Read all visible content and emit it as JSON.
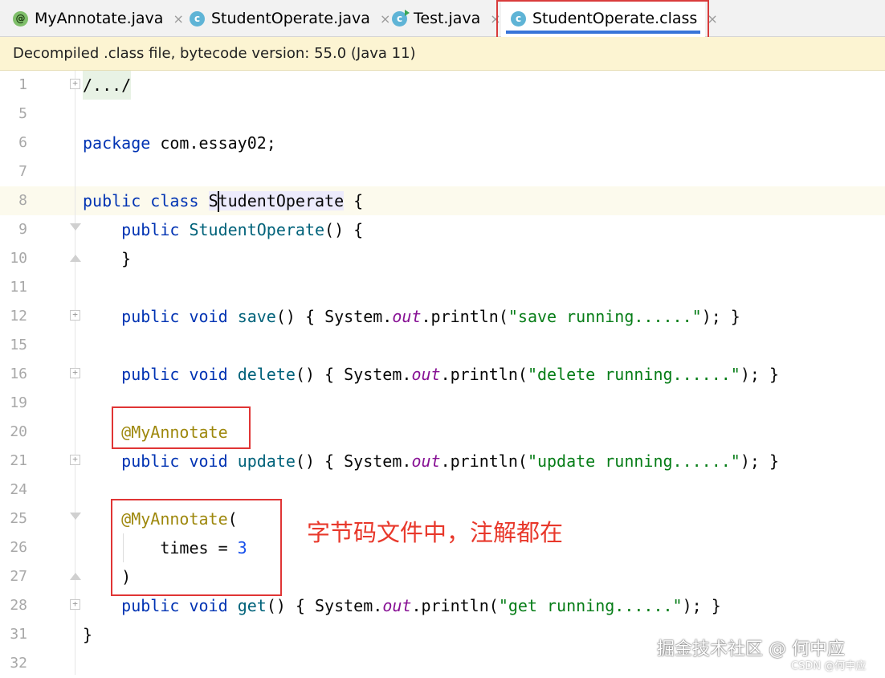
{
  "tabs": [
    {
      "label": "MyAnnotate.java",
      "icon": "annotation-icon",
      "active": false
    },
    {
      "label": "StudentOperate.java",
      "icon": "class-icon",
      "active": false
    },
    {
      "label": "Test.java",
      "icon": "runnable-class-icon",
      "active": false
    },
    {
      "label": "StudentOperate.class",
      "icon": "class-icon",
      "active": true
    }
  ],
  "tab_close_glyph": "×",
  "banner": "Decompiled .class file, bytecode version: 55.0 (Java 11)",
  "lines": [
    {
      "num": "1",
      "text": "/.../"
    },
    {
      "num": "5",
      "text": ""
    },
    {
      "num": "6",
      "text": "package com.essay02;"
    },
    {
      "num": "7",
      "text": ""
    },
    {
      "num": "8",
      "text": "public class StudentOperate {"
    },
    {
      "num": "9",
      "text": "    public StudentOperate() {"
    },
    {
      "num": "10",
      "text": "    }"
    },
    {
      "num": "11",
      "text": ""
    },
    {
      "num": "12",
      "text": "    public void save() { System.out.println(\"save running......\"); }"
    },
    {
      "num": "15",
      "text": ""
    },
    {
      "num": "16",
      "text": "    public void delete() { System.out.println(\"delete running......\"); }"
    },
    {
      "num": "19",
      "text": ""
    },
    {
      "num": "20",
      "text": "    @MyAnnotate"
    },
    {
      "num": "21",
      "text": "    public void update() { System.out.println(\"update running......\"); }"
    },
    {
      "num": "24",
      "text": ""
    },
    {
      "num": "25",
      "text": "    @MyAnnotate("
    },
    {
      "num": "26",
      "text": "        times = 3"
    },
    {
      "num": "27",
      "text": "    )"
    },
    {
      "num": "28",
      "text": "    public void get() { System.out.println(\"get running......\"); }"
    },
    {
      "num": "31",
      "text": "}"
    },
    {
      "num": "32",
      "text": ""
    }
  ],
  "annotation_note": "字节码文件中，注解都在",
  "watermark": "掘金技术社区 @ 何中应",
  "watermark_small": "CSDN @何中应",
  "colors": {
    "keyword": "#0033b3",
    "method": "#00627a",
    "string": "#067d17",
    "annotation": "#9e880d",
    "number": "#1750eb",
    "static_field": "#871094",
    "highlight_box": "#e03535",
    "active_tab_underline": "#3874d8",
    "banner_bg": "#fcf4d2"
  }
}
